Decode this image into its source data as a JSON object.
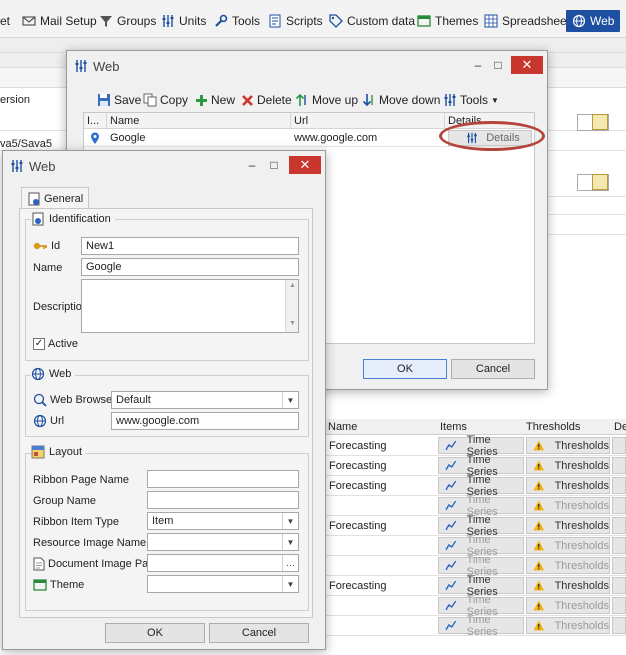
{
  "ribbon": {
    "items": [
      {
        "label": "et",
        "icon": "partial-icon"
      },
      {
        "label": "Mail Setup",
        "icon": "mail-icon"
      },
      {
        "label": "Groups",
        "icon": "filter-icon"
      },
      {
        "label": "Units",
        "icon": "sliders-icon"
      },
      {
        "label": "Tools",
        "icon": "wrench-icon"
      },
      {
        "label": "Scripts",
        "icon": "scripts-icon"
      },
      {
        "label": "Custom data",
        "icon": "tag-icon"
      },
      {
        "label": "Themes",
        "icon": "themes-icon"
      },
      {
        "label": "Spreadsheets",
        "icon": "spreadsheet-icon"
      },
      {
        "label": "Web",
        "icon": "globe-icon",
        "active": true
      }
    ]
  },
  "background": {
    "left_texts": [
      "ersion",
      "va5/Sava5"
    ],
    "grid_columns": {
      "name": "Name",
      "items": "Items",
      "thresholds": "Thresholds",
      "det": "Det"
    },
    "rows": [
      {
        "name": "Forecasting",
        "items": "Time Series",
        "thresholds": "Thresholds",
        "dim": false
      },
      {
        "name": "Forecasting",
        "items": "Time Series",
        "thresholds": "Thresholds",
        "dim": false
      },
      {
        "name": "Forecasting",
        "items": "Time Series",
        "thresholds": "Thresholds",
        "dim": false
      },
      {
        "name": "",
        "items": "Time Series",
        "thresholds": "Thresholds",
        "dim": true
      },
      {
        "name": "Forecasting",
        "items": "Time Series",
        "thresholds": "Thresholds",
        "dim": false
      },
      {
        "name": "",
        "items": "Time Series",
        "thresholds": "Thresholds",
        "dim": true
      },
      {
        "name": "",
        "items": "Time Series",
        "thresholds": "Thresholds",
        "dim": true
      },
      {
        "name": "Forecasting",
        "items": "Time Series",
        "thresholds": "Thresholds",
        "dim": false
      },
      {
        "name": "",
        "items": "Time Series",
        "thresholds": "Thresholds",
        "dim": true
      },
      {
        "name": "",
        "items": "Time Series",
        "thresholds": "Thresholds",
        "dim": true
      }
    ]
  },
  "web_list_dialog": {
    "title": "Web",
    "toolbar": {
      "save": "Save",
      "copy": "Copy",
      "new": "New",
      "delete": "Delete",
      "move_up": "Move up",
      "move_down": "Move down",
      "tools": "Tools"
    },
    "columns": {
      "icon_col": "I...",
      "name": "Name",
      "url": "Url",
      "details": "Details"
    },
    "rows": [
      {
        "name": "Google",
        "url": "www.google.com",
        "details": "Details"
      }
    ],
    "ok": "OK",
    "cancel": "Cancel"
  },
  "web_edit_dialog": {
    "title": "Web",
    "tab": "General",
    "identification": {
      "title": "Identification",
      "id_label": "Id",
      "id_value": "New1",
      "name_label": "Name",
      "name_value": "Google",
      "description_label": "Description",
      "description_value": "",
      "active_label": "Active",
      "active_checked": true
    },
    "web": {
      "title": "Web",
      "browser_label": "Web Browser",
      "browser_value": "Default",
      "url_label": "Url",
      "url_value": "www.google.com"
    },
    "layout": {
      "title": "Layout",
      "ribbon_page_label": "Ribbon Page Name",
      "ribbon_page_value": "",
      "group_label": "Group Name",
      "group_value": "",
      "ribbon_type_label": "Ribbon Item Type",
      "ribbon_type_value": "Item",
      "resource_image_label": "Resource Image Name",
      "resource_image_value": "",
      "document_image_label": "Document Image Path",
      "document_image_value": "",
      "theme_label": "Theme",
      "theme_value": ""
    },
    "ok": "OK",
    "cancel": "Cancel"
  },
  "colors": {
    "accent": "#1e4fa0",
    "close": "#c9362e",
    "highlight_ring": "#b5453a"
  }
}
